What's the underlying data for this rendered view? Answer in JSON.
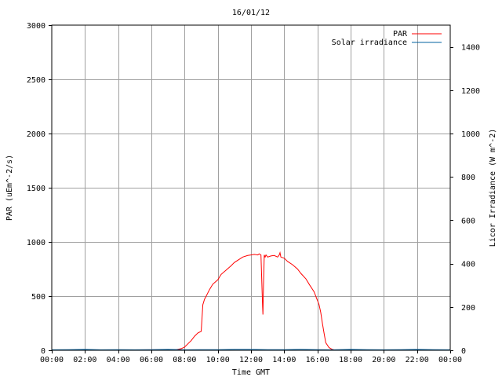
{
  "colors": {
    "par": "#ff0000",
    "solar": "#0060a0",
    "grid": "#a0a0a0",
    "frame": "#000000",
    "background": "#ffffff"
  },
  "chart_data": {
    "type": "line",
    "title": "16/01/12",
    "xlabel": "Time GMT",
    "ylabel": "PAR (uEm^-2/s)",
    "y2label": "Licor Irradiance (W m^-2)",
    "xlim": [
      0,
      24
    ],
    "ylim": [
      0,
      3000
    ],
    "y2lim": [
      0,
      1500
    ],
    "x_tick_values": [
      0,
      2,
      4,
      6,
      8,
      10,
      12,
      14,
      16,
      18,
      20,
      22,
      24
    ],
    "x_tick_labels": [
      "00:00",
      "02:00",
      "04:00",
      "06:00",
      "08:00",
      "10:00",
      "12:00",
      "14:00",
      "16:00",
      "18:00",
      "20:00",
      "22:00",
      "00:00"
    ],
    "y_ticks": [
      0,
      500,
      1000,
      1500,
      2000,
      2500,
      3000
    ],
    "y2_ticks": [
      0,
      200,
      400,
      600,
      800,
      1000,
      1200,
      1400
    ],
    "grid": true,
    "legend_position": "top-right",
    "legend": [
      "PAR",
      "Solar irradiance"
    ],
    "series": [
      {
        "name": "PAR",
        "axis": "left",
        "color": "#ff0000",
        "x": [
          0,
          7.5,
          7.8,
          8.0,
          8.2,
          8.4,
          8.6,
          8.8,
          9.0,
          9.1,
          9.2,
          9.3,
          9.5,
          9.7,
          10.0,
          10.2,
          10.5,
          10.8,
          11.0,
          11.3,
          11.5,
          11.8,
          12.0,
          12.2,
          12.4,
          12.5,
          12.6,
          12.7,
          12.72,
          12.75,
          12.8,
          12.85,
          12.9,
          13.0,
          13.2,
          13.4,
          13.6,
          13.7,
          13.75,
          13.8,
          14.0,
          14.2,
          14.5,
          14.8,
          15.0,
          15.3,
          15.5,
          15.8,
          16.0,
          16.1,
          16.2,
          16.3,
          16.4,
          16.5,
          16.7,
          16.9,
          17.1,
          24
        ],
        "y": [
          0,
          5,
          15,
          30,
          60,
          90,
          130,
          160,
          175,
          420,
          470,
          500,
          560,
          610,
          650,
          700,
          740,
          780,
          810,
          840,
          860,
          875,
          880,
          885,
          880,
          890,
          880,
          400,
          330,
          600,
          880,
          860,
          880,
          860,
          870,
          875,
          860,
          880,
          900,
          860,
          850,
          820,
          790,
          750,
          710,
          660,
          610,
          540,
          460,
          420,
          350,
          250,
          160,
          70,
          25,
          8,
          0,
          0
        ]
      },
      {
        "name": "Solar irradiance",
        "axis": "right",
        "color": "#0060a0",
        "x": [
          0,
          1,
          2,
          3,
          4,
          5,
          6,
          7,
          8,
          9,
          10,
          11,
          12,
          13,
          14,
          15,
          16,
          17,
          18,
          19,
          20,
          21,
          22,
          23,
          24
        ],
        "y": [
          2,
          3,
          4,
          2,
          3,
          2,
          3,
          4,
          2,
          3,
          3,
          4,
          4,
          3,
          3,
          4,
          3,
          2,
          4,
          3,
          2,
          3,
          4,
          3,
          2
        ]
      }
    ]
  }
}
